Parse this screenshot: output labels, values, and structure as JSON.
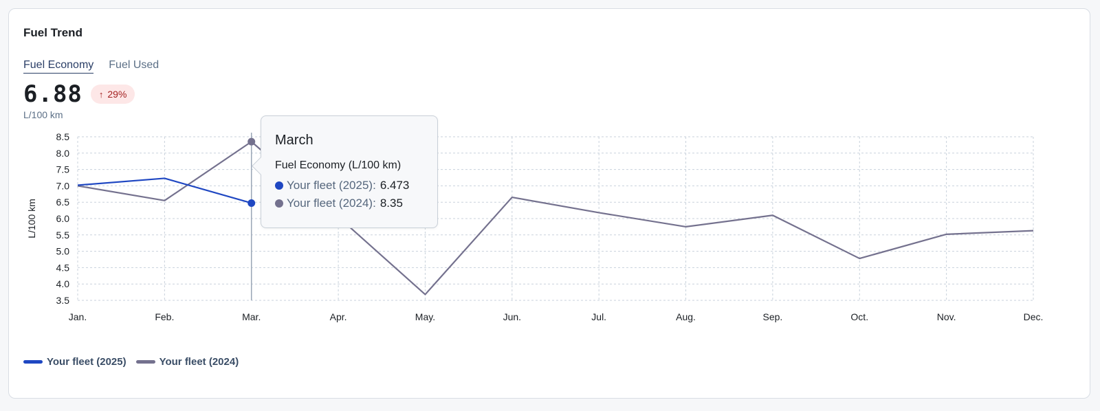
{
  "card": {
    "title": "Fuel Trend",
    "tabs": [
      {
        "label": "Fuel Economy",
        "active": true
      },
      {
        "label": "Fuel Used",
        "active": false
      }
    ],
    "kpi": {
      "value": "6.88",
      "change": "29%",
      "unit": "L/100 km"
    }
  },
  "colors": {
    "series_2025": "#1f47c2",
    "series_2024": "#74718e",
    "badge_bg": "#fde7e7",
    "badge_text": "#a32020"
  },
  "tooltip": {
    "month": "March",
    "metric": "Fuel Economy (L/100 km)",
    "rows": [
      {
        "name": "Your fleet (2025)",
        "value": "6.473"
      },
      {
        "name": "Your fleet (2024)",
        "value": "8.35"
      }
    ]
  },
  "chart_data": {
    "type": "line",
    "categories": [
      "Jan.",
      "Feb.",
      "Mar.",
      "Apr.",
      "May.",
      "Jun.",
      "Jul.",
      "Aug.",
      "Sep.",
      "Oct.",
      "Nov.",
      "Dec."
    ],
    "ylabel": "L/100 km",
    "ylim": [
      3.5,
      8.5
    ],
    "yticks": [
      "8.5",
      "8.0",
      "7.5",
      "7.0",
      "6.5",
      "6.0",
      "5.5",
      "5.0",
      "4.5",
      "4.0",
      "3.5"
    ],
    "grid": true,
    "legend": "bottom-left",
    "highlight_index": 2,
    "series": [
      {
        "name": "Your fleet (2025)",
        "values": [
          7.02,
          7.23,
          6.473
        ]
      },
      {
        "name": "Your fleet (2024)",
        "values": [
          7.0,
          6.55,
          8.35,
          6.05,
          3.68,
          6.65,
          6.18,
          5.75,
          6.1,
          4.78,
          5.52,
          5.63
        ]
      }
    ]
  }
}
